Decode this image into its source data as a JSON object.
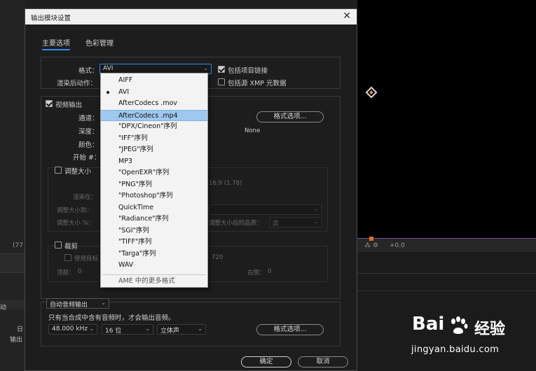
{
  "dialog": {
    "title": "输出模块设置",
    "close_glyph": "✕",
    "tabs": [
      "主要选项",
      "色彩管理"
    ]
  },
  "format": {
    "label": "格式：",
    "value": "AVI",
    "include_project_link": "包括项目链接",
    "include_xmp": "包括源 XMP 元数据"
  },
  "post_render": {
    "label": "渲染后动作："
  },
  "video": {
    "label": "视频输出",
    "channels": "通道：",
    "depth": "深度：",
    "color": "颜色：",
    "start": "开始 #：",
    "format_options_button": "格式选项...",
    "none": "None"
  },
  "resize": {
    "label": "调整大小",
    "render_at": "渲染在：",
    "ratio": "16:9 (1.78)",
    "resize_to": "调整大小到：",
    "resize_pct": "调整大小 %：",
    "quality": "调整大小后的品质：",
    "quality_value": "高"
  },
  "crop": {
    "label": "裁剪",
    "use_region": "使用目标",
    "region_value": "720",
    "top": "顶部：",
    "top_value": "0",
    "left": "左侧：",
    "left_value": "0",
    "right": "右侧：",
    "right_value": "0"
  },
  "audio": {
    "mode": "自动音频输出",
    "note": "只有当合成中含有音频时，才会输出音频。",
    "rate": "48.000 kHz",
    "bits": "16 位",
    "channels": "立体声",
    "format_options_button": "格式选项..."
  },
  "buttons": {
    "ok": "确定",
    "cancel": "取消"
  },
  "menu": {
    "items": [
      "AIFF",
      "AVI",
      "AfterCodecs .mov",
      "AfterCodecs .mp4",
      "\"DPX/Cineon\"序列",
      "\"IFF\"序列",
      "\"JPEG\"序列",
      "MP3",
      "\"OpenEXR\"序列",
      "\"PNG\"序列",
      "\"Photoshop\"序列",
      "QuickTime",
      "\"Radiance\"序列",
      "\"SGI\"序列",
      "\"TIFF\"序列",
      "\"Targa\"序列",
      "WAV"
    ],
    "more": "AME 中的更多格式",
    "checked": "AVI",
    "highlighted": "AfterCodecs .mp4"
  },
  "background": {
    "left_labels": [
      "动",
      "日",
      "输出"
    ],
    "strip_zoom": "+0.0",
    "strip_left": "(77"
  },
  "watermark": {
    "logo": "Bai",
    "jing": "经验",
    "url": "jingyan.baidu.com"
  }
}
